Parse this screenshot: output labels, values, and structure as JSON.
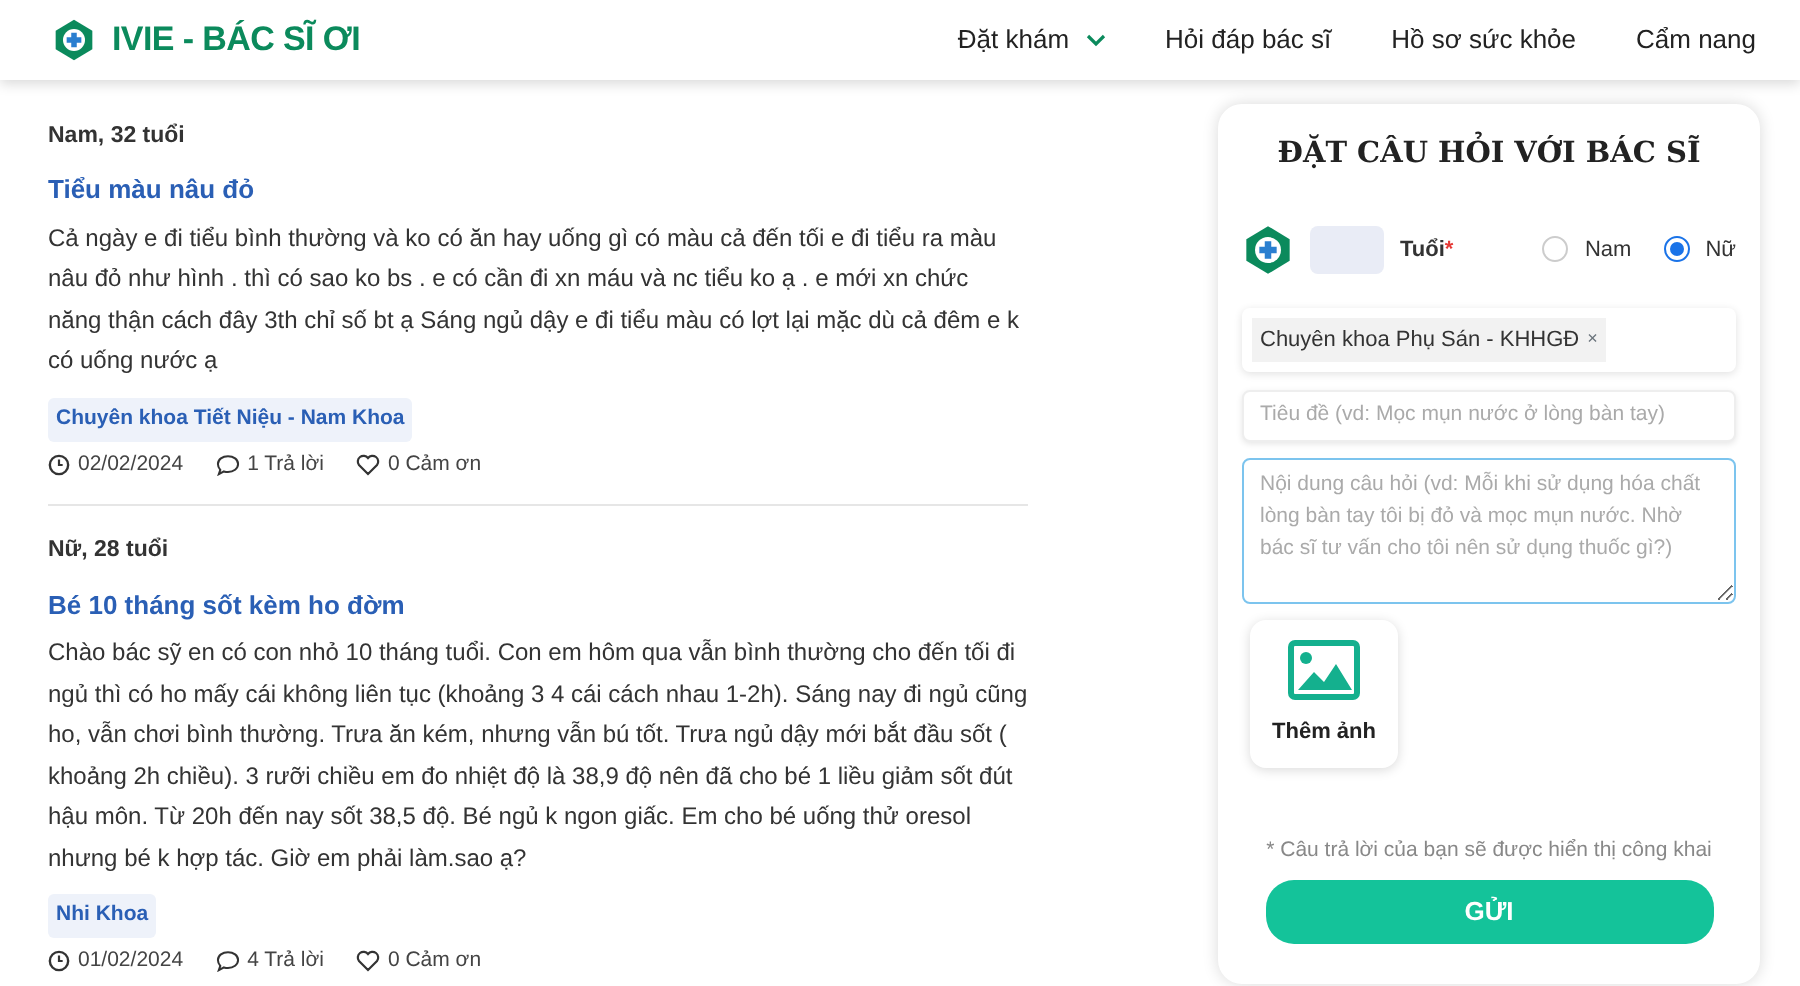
{
  "logo": {
    "text": "IVIE - BÁC SĨ ƠI"
  },
  "nav": [
    {
      "label": "Đặt khám",
      "dropdown": true
    },
    {
      "label": "Hỏi đáp bác sĩ",
      "dropdown": false
    },
    {
      "label": "Hồ sơ sức khỏe",
      "dropdown": false
    },
    {
      "label": "Cẩm nang",
      "dropdown": false
    }
  ],
  "questions": [
    {
      "author": "Nam, 32 tuổi",
      "title": "Tiểu màu nâu đỏ",
      "body": "Cả ngày e đi tiểu bình thường và ko có ăn hay uống gì có màu cả đến tối e đi tiểu ra màu nâu đỏ như hình . thì có sao ko bs . e có cần đi xn máu và nc tiểu ko ạ . e mới xn chức năng thận cách đây 3th chỉ số bt ạ Sáng ngủ dậy e đi tiểu màu có lợt lại mặc dù cả đêm e k có uống nước ạ",
      "tag": "Chuyên khoa Tiết Niệu - Nam Khoa",
      "date": "02/02/2024",
      "replies": "1 Trả lời",
      "thanks": "0 Cảm ơn"
    },
    {
      "author": "Nữ, 28 tuổi",
      "title": "Bé 10 tháng sốt kèm ho đờm",
      "body": "Chào bác sỹ en có con nhỏ 10 tháng tuổi. Con em hôm qua vẫn bình thường cho đến tối đi ngủ thì có ho mấy cái không liên tục (khoảng 3 4 cái cách nhau 1-2h). Sáng nay đi ngủ cũng ho, vẫn chơi bình thường. Trưa ăn kém, nhưng vẫn bú tốt. Trưa ngủ dậy mới bắt đầu sốt ( khoảng 2h chiều). 3 rưỡi chiều em đo nhiệt độ là 38,9 độ nên đã cho bé 1 liều giảm sốt đút hậu môn. Từ 20h đến nay sốt 38,5 độ. Bé ngủ k ngon giấc. Em cho bé uống thử oresol nhưng bé k hợp tác. Giờ em phải làm.sao ạ?",
      "tag": "Nhi Khoa",
      "date": "01/02/2024",
      "replies": "4 Trả lời",
      "thanks": "0 Cảm ơn"
    }
  ],
  "form": {
    "title": "ĐẶT CÂU HỎI VỚI BÁC SĨ",
    "age_label": "Tuổi",
    "age_required_mark": "*",
    "genders": [
      {
        "label": "Nam",
        "selected": false
      },
      {
        "label": "Nữ",
        "selected": true
      }
    ],
    "specialty": "Chuyên khoa Phụ Sán - KHHGĐ",
    "specialty_remove": "×",
    "title_placeholder": "Tiêu đề (vd: Mọc mụn nước ở lòng bàn tay)",
    "content_placeholder": "Nội dung câu hỏi (vd: Mỗi khi sử dụng hóa chất lòng bàn tay tôi bị đỏ và mọc mụn nước. Nhờ bác sĩ tư vấn cho tôi nên sử dụng thuốc gì?)",
    "add_photo": "Thêm ảnh",
    "note": "* Câu trả lời của bạn sẽ được hiển thị công khai",
    "submit": "GỬI"
  }
}
